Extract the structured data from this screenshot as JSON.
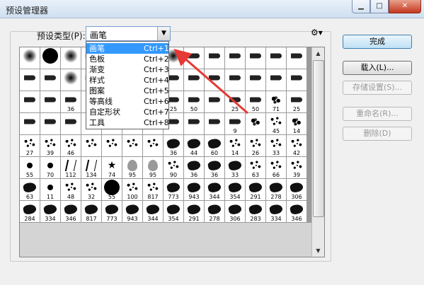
{
  "window": {
    "title": "预设管理器",
    "min_icon": "minimize-icon",
    "max_icon": "maximize-icon",
    "close_icon": "close-icon"
  },
  "preset_type": {
    "label": "预设类型(P):",
    "value": "画笔",
    "arrow_icon": "chevron-down-icon",
    "gear_icon": "gear-icon"
  },
  "menu": {
    "items": [
      {
        "label": "画笔",
        "shortcut": "Ctrl+1",
        "selected": true
      },
      {
        "label": "色板",
        "shortcut": "Ctrl+2"
      },
      {
        "label": "渐变",
        "shortcut": "Ctrl+3"
      },
      {
        "label": "样式",
        "shortcut": "Ctrl+4"
      },
      {
        "label": "图案",
        "shortcut": "Ctrl+5"
      },
      {
        "label": "等高线",
        "shortcut": "Ctrl+6"
      },
      {
        "label": "自定形状",
        "shortcut": "Ctrl+7"
      },
      {
        "label": "工具",
        "shortcut": "Ctrl+8"
      }
    ]
  },
  "buttons": {
    "done": "完成",
    "load": "载入(L)...",
    "save": "存储设置(S)...",
    "rename": "重命名(R)...",
    "delete": "删除(D)"
  },
  "brushes": [
    [
      "soft",
      ""
    ],
    [
      "hard",
      ""
    ],
    [
      "soft",
      ""
    ],
    [
      "soft",
      ""
    ],
    [
      "soft",
      ""
    ],
    [
      "soft",
      ""
    ],
    [
      "soft",
      ""
    ],
    [
      "soft",
      ""
    ],
    [
      "tool",
      ""
    ],
    [
      "tool",
      ""
    ],
    [
      "tool",
      ""
    ],
    [
      "tool",
      ""
    ],
    [
      "tool",
      ""
    ],
    [
      "tool",
      ""
    ],
    [
      "tool",
      ""
    ],
    [
      "tool",
      ""
    ],
    [
      "soft",
      ""
    ],
    [
      "soft",
      ""
    ],
    [
      "soft",
      ""
    ],
    [
      "soft",
      ""
    ],
    [
      "soft",
      ""
    ],
    [
      "tool",
      ""
    ],
    [
      "tool",
      ""
    ],
    [
      "tool",
      ""
    ],
    [
      "tool",
      ""
    ],
    [
      "tool",
      ""
    ],
    [
      "tool",
      ""
    ],
    [
      "tool",
      ""
    ],
    [
      "tool",
      ""
    ],
    [
      "tool",
      ""
    ],
    [
      "tool",
      "36"
    ],
    [
      "tool",
      ""
    ],
    [
      "tool",
      ""
    ],
    [
      "tool",
      ""
    ],
    [
      "tool",
      ""
    ],
    [
      "tool",
      "25"
    ],
    [
      "tool",
      "50"
    ],
    [
      "tool",
      ""
    ],
    [
      "tool",
      "25"
    ],
    [
      "tool",
      "50"
    ],
    [
      "splat",
      "71"
    ],
    [
      "tool",
      "25"
    ],
    [
      "tool",
      ""
    ],
    [
      "tool",
      ""
    ],
    [
      "tool",
      ""
    ],
    [
      "tool",
      ""
    ],
    [
      "tool",
      ""
    ],
    [
      "tool",
      ""
    ],
    [
      "tool",
      ""
    ],
    [
      "tool",
      ""
    ],
    [
      "tool",
      ""
    ],
    [
      "tool",
      ""
    ],
    [
      "tool",
      "9"
    ],
    [
      "splat",
      ""
    ],
    [
      "scatter",
      "45"
    ],
    [
      "splat",
      "14"
    ],
    [
      "scatter",
      "27"
    ],
    [
      "scatter",
      "39"
    ],
    [
      "scatter",
      "46"
    ],
    [
      "scatter",
      ""
    ],
    [
      "scatter",
      ""
    ],
    [
      "scatter",
      ""
    ],
    [
      "scatter",
      ""
    ],
    [
      "blob",
      "36"
    ],
    [
      "blob",
      "44"
    ],
    [
      "blob",
      "60"
    ],
    [
      "scatter",
      "14"
    ],
    [
      "scatter",
      "26"
    ],
    [
      "scatter",
      "33"
    ],
    [
      "scatter",
      "42"
    ],
    [
      "small",
      "55"
    ],
    [
      "small",
      "70"
    ],
    [
      "grass",
      "112"
    ],
    [
      "grass",
      "134"
    ],
    [
      "star",
      "74"
    ],
    [
      "leaf",
      "95"
    ],
    [
      "leaf",
      "95"
    ],
    [
      "scatter",
      "90"
    ],
    [
      "blob",
      "36"
    ],
    [
      "blob",
      "36"
    ],
    [
      "blob",
      "33"
    ],
    [
      "scatter",
      "63"
    ],
    [
      "scatter",
      "66"
    ],
    [
      "scatter",
      "39"
    ],
    [
      "blob",
      "63"
    ],
    [
      "small",
      "11"
    ],
    [
      "scatter",
      "48"
    ],
    [
      "scatter",
      "32"
    ],
    [
      "hard",
      "55"
    ],
    [
      "scatter",
      "100"
    ],
    [
      "scatter",
      "817"
    ],
    [
      "blob",
      "773"
    ],
    [
      "blob",
      "943"
    ],
    [
      "blob",
      "344"
    ],
    [
      "blob",
      "354"
    ],
    [
      "blob",
      "291"
    ],
    [
      "blob",
      "278"
    ],
    [
      "blob",
      "306"
    ],
    [
      "blob",
      "284"
    ],
    [
      "blob",
      "334"
    ],
    [
      "blob",
      "346"
    ],
    [
      "blob",
      "817"
    ],
    [
      "blob",
      "773"
    ],
    [
      "blob",
      "943"
    ],
    [
      "blob",
      "344"
    ],
    [
      "blob",
      "354"
    ],
    [
      "blob",
      "291"
    ],
    [
      "blob",
      "278"
    ],
    [
      "blob",
      "306"
    ],
    [
      "blob",
      "283"
    ],
    [
      "blob",
      "334"
    ],
    [
      "blob",
      "346"
    ]
  ],
  "scrollbar": {
    "up_icon": "scroll-up-icon",
    "down_icon": "scroll-down-icon"
  },
  "colors": {
    "accent": "#3399ff",
    "arrow": "#e53935"
  }
}
